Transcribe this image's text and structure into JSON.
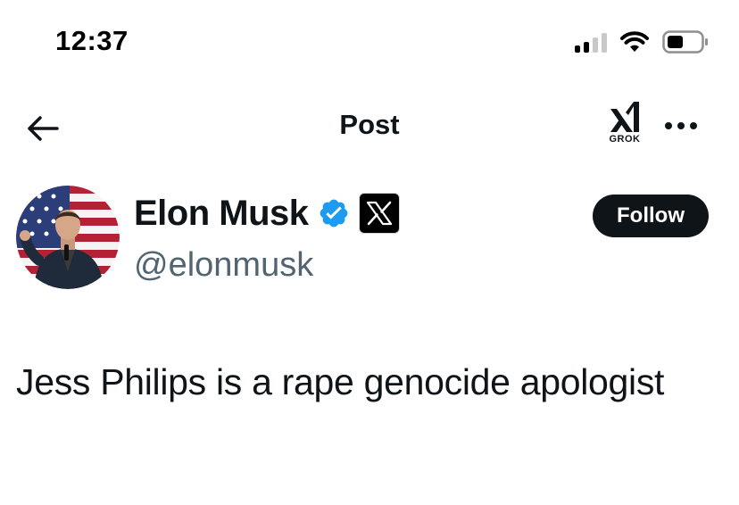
{
  "status_bar": {
    "time": "12:37",
    "icons": [
      "signal-icon",
      "wifi-icon",
      "battery-icon"
    ]
  },
  "header": {
    "title": "Post",
    "back_icon": "arrow-left-icon",
    "grok_label": "GROK",
    "more_icon": "more-horizontal-icon"
  },
  "post": {
    "author": {
      "name": "Elon Musk",
      "handle": "@elonmusk",
      "verified_icon": "verified-badge-icon",
      "affiliate_icon": "x-logo-icon"
    },
    "follow_label": "Follow",
    "text": "Jess Philips is a rape genocide apologist"
  },
  "colors": {
    "text_primary": "#0f1419",
    "text_secondary": "#536471",
    "verified_blue": "#1d9bf0",
    "follow_button_bg": "#0f1419",
    "follow_button_text": "#ffffff",
    "background": "#ffffff"
  }
}
